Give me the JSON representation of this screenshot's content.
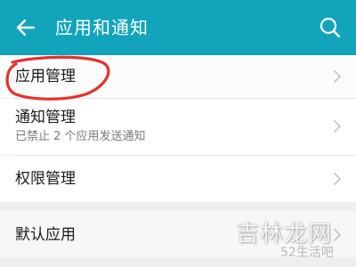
{
  "header": {
    "title": "应用和通知",
    "background_color": "#12a4ba",
    "back_icon": "arrow-left",
    "search_icon": "search"
  },
  "items": [
    {
      "title": "应用管理",
      "subtitle": "",
      "annotation_color": "#e5322d"
    },
    {
      "title": "通知管理",
      "subtitle": "已禁止 2 个应用发送通知"
    },
    {
      "title": "权限管理",
      "subtitle": ""
    },
    {
      "title": "默认应用",
      "subtitle": ""
    }
  ],
  "watermark": {
    "main": "吉林龙网",
    "sub": "52生活吧"
  }
}
